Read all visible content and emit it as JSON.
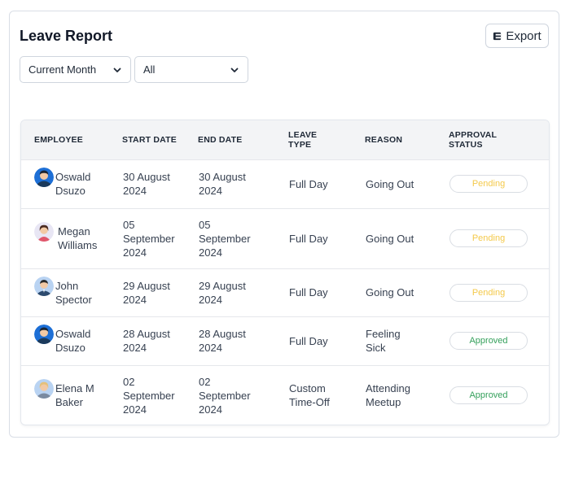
{
  "header": {
    "title": "Leave Report",
    "export_label": "Export"
  },
  "filters": {
    "period": "Current Month",
    "status": "All"
  },
  "table": {
    "columns": [
      "EMPLOYEE",
      "START DATE",
      "END DATE",
      "LEAVE TYPE",
      "REASON",
      "APPROVAL STATUS"
    ],
    "rows": [
      {
        "employee": "Oswald Dsuzo",
        "start": "30 August 2024",
        "end": "30 August 2024",
        "type": "Full Day",
        "reason": "Going Out",
        "status": "Pending"
      },
      {
        "employee": "Megan Williams",
        "start": "05 September 2024",
        "end": "05 September 2024",
        "type": "Full Day",
        "reason": "Going Out",
        "status": "Pending"
      },
      {
        "employee": "John Spector",
        "start": "29 August 2024",
        "end": "29 August 2024",
        "type": "Full Day",
        "reason": "Going Out",
        "status": "Pending"
      },
      {
        "employee": "Oswald Dsuzo",
        "start": "28 August 2024",
        "end": "28 August 2024",
        "type": "Full Day",
        "reason": "Feeling Sick",
        "status": "Approved"
      },
      {
        "employee": "Elena M Baker",
        "start": "02 September 2024",
        "end": "02 September 2024",
        "type": "Custom Time-Off",
        "reason": "Attending Meetup",
        "status": "Approved"
      }
    ]
  },
  "colors": {
    "pending": "#f4c94a",
    "approved": "#35a05c"
  },
  "icons": {
    "export": "export-icon",
    "dropdown": "chevron-down-icon",
    "avatar": "avatar"
  }
}
